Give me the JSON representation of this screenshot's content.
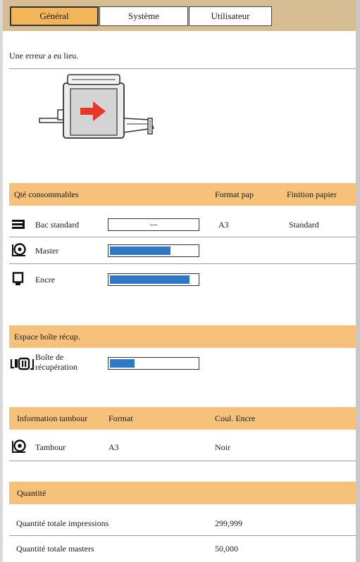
{
  "tabs": [
    {
      "label": "Général",
      "active": true
    },
    {
      "label": "Système",
      "active": false
    },
    {
      "label": "Utilisateur",
      "active": false
    }
  ],
  "status_message": "Une erreur a eu lieu.",
  "printer_diagram": {
    "icon": "printer-error-arrow-icon",
    "arrow_color": "#e8362a"
  },
  "consumables": {
    "header": {
      "col1": "Qté consommables",
      "col2": "Format pap",
      "col3": "Finition papier"
    },
    "rows": [
      {
        "icon": "paper-tray-icon",
        "label": "Bac standard",
        "gauge_text": "---",
        "level": null,
        "format": "A3",
        "finish": "Standard"
      },
      {
        "icon": "master-roll-icon",
        "label": "Master",
        "gauge_text": "",
        "level": 0.68,
        "format": "",
        "finish": ""
      },
      {
        "icon": "ink-cartridge-icon",
        "label": "Encre",
        "gauge_text": "",
        "level": 0.9,
        "format": "",
        "finish": ""
      }
    ]
  },
  "waste_box": {
    "header": "Espace boîte récup.",
    "icon": "disposal-box-icon",
    "label_line1": "Boîte de",
    "label_line2": "récupération",
    "level": 0.28
  },
  "drum": {
    "header": {
      "col1": "Information tambour",
      "col2": "Format",
      "col3": "Coul. Encre"
    },
    "icon": "drum-icon",
    "label": "Tambour",
    "format": "A3",
    "ink_color": "Noir"
  },
  "quantity": {
    "header": "Quantité",
    "rows": [
      {
        "label": "Quantité totale impressions",
        "value": "299,999"
      },
      {
        "label": "Quantité totale masters",
        "value": "50,000"
      }
    ]
  },
  "colors": {
    "tab_bar": "#d6bd94",
    "section_band": "#f6c27b",
    "active_tab": "#f2b55a",
    "gauge_fill": "#2f79c4"
  }
}
